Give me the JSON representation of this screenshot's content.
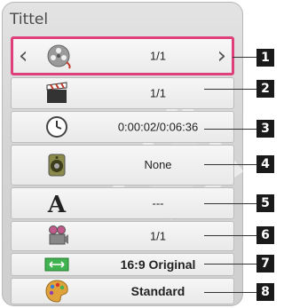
{
  "panel": {
    "title": "Tittel"
  },
  "rows": [
    {
      "icon": "film-reel-icon",
      "value": "1/1"
    },
    {
      "icon": "clapperboard-icon",
      "value": "1/1"
    },
    {
      "icon": "clock-icon",
      "value": "0:00:02/0:06:36"
    },
    {
      "icon": "speaker-icon",
      "value": "None"
    },
    {
      "icon": "subtitle-a-icon",
      "value": "---"
    },
    {
      "icon": "camera-angle-icon",
      "value": "1/1"
    },
    {
      "icon": "aspect-ratio-icon",
      "value": "16:9 Original"
    },
    {
      "icon": "palette-icon",
      "value": "Standard"
    }
  ],
  "callouts": [
    "1",
    "2",
    "3",
    "4",
    "5",
    "6",
    "7",
    "8"
  ],
  "nav": {
    "prev_glyph": "‹",
    "next_glyph": "›"
  },
  "colors": {
    "selection": "#e0407a",
    "callout_badge": "#1a1a1a"
  }
}
